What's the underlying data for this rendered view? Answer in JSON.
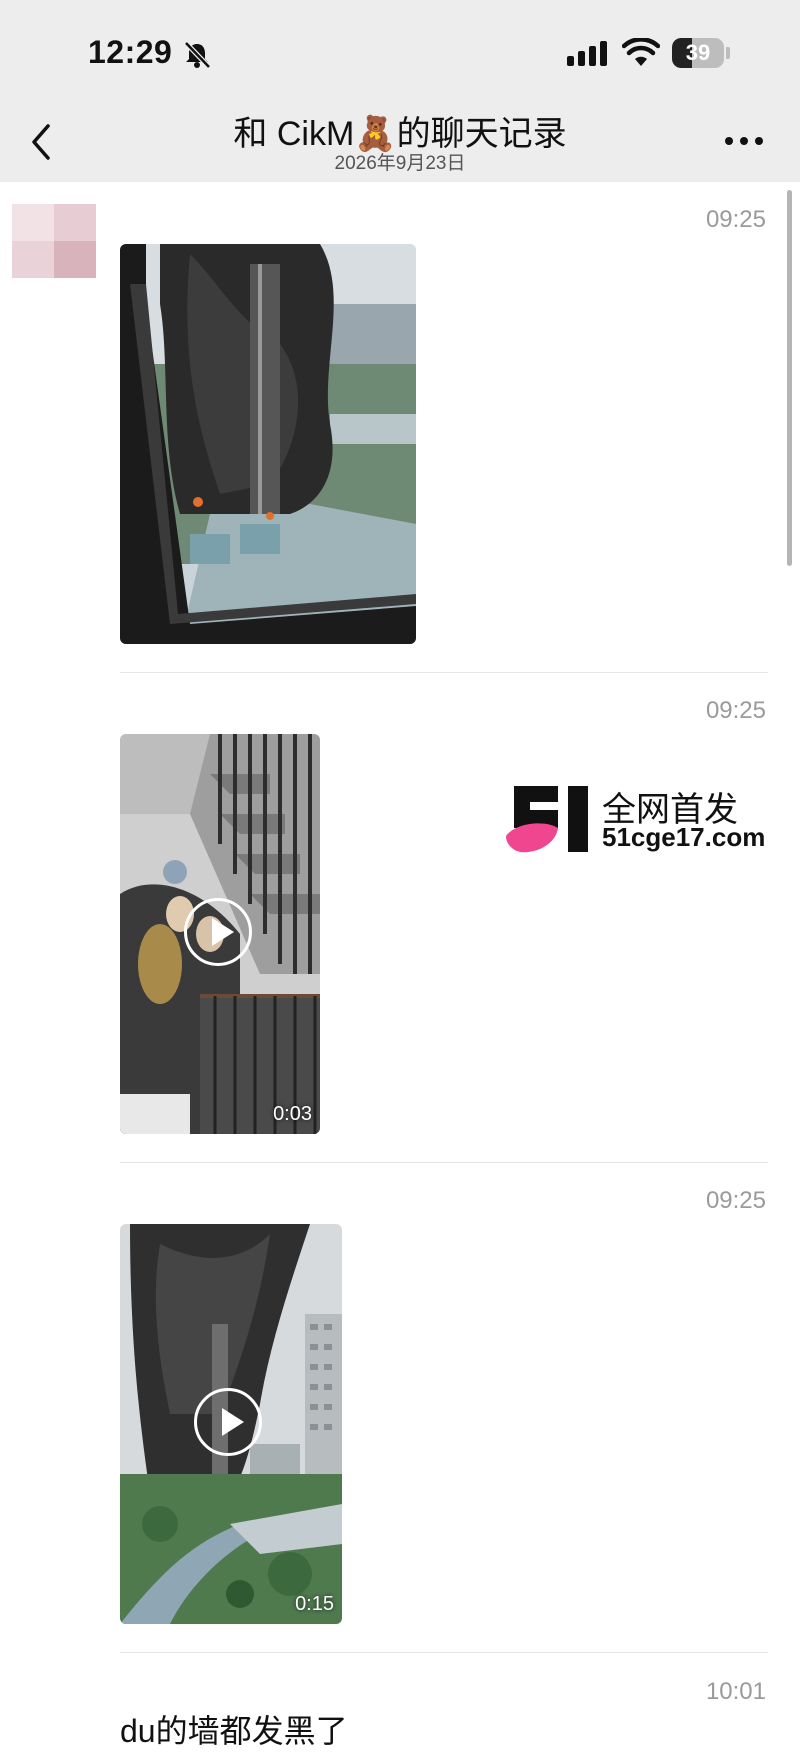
{
  "status": {
    "time": "12:29",
    "battery": "39",
    "battery_fraction": 0.39
  },
  "header": {
    "title": "和 CikM🧸的聊天记录",
    "date": "2026年9月23日"
  },
  "messages": [
    {
      "time": "09:25",
      "type": "image"
    },
    {
      "time": "09:25",
      "type": "video",
      "duration": "0:03"
    },
    {
      "time": "09:25",
      "type": "video",
      "duration": "0:15"
    },
    {
      "time": "10:01",
      "type": "text",
      "text": "du的墙都发黑了"
    }
  ],
  "watermark": {
    "line1": "全网首发",
    "line2": "51cge17.com",
    "logo_text": "51"
  },
  "icons": [
    "bell-muted-icon",
    "signal-icon",
    "wifi-icon",
    "battery-icon",
    "back-icon",
    "more-icon",
    "play-icon"
  ],
  "colors": {
    "bar": "#ededed",
    "time_gray": "#9a9a9a",
    "logo_pink": "#f0468f"
  }
}
